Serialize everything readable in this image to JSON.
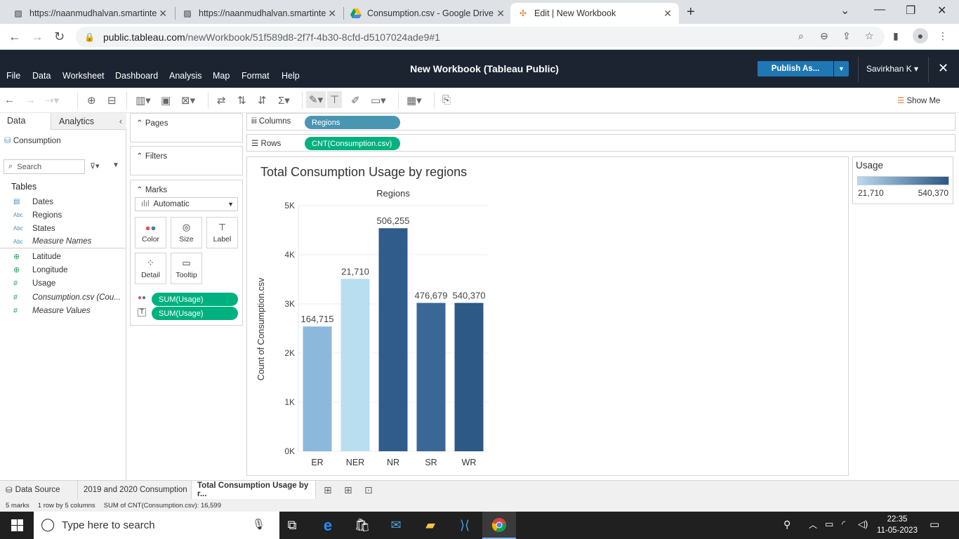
{
  "browser": {
    "tabs": [
      {
        "title": "https://naanmudhalvan.smartinte",
        "active": false
      },
      {
        "title": "https://naanmudhalvan.smartinte",
        "active": false
      },
      {
        "title": "Consumption.csv - Google Drive",
        "active": false
      },
      {
        "title": "Edit | New Workbook",
        "active": true
      }
    ],
    "url_host": "public.tableau.com",
    "url_path": "/newWorkbook/51f589d8-2f7f-4b30-8cfd-d5107024ade9#1"
  },
  "app": {
    "menu": [
      "File",
      "Data",
      "Worksheet",
      "Dashboard",
      "Analysis",
      "Map",
      "Format",
      "Help"
    ],
    "title": "New Workbook (Tableau Public)",
    "publish_label": "Publish As...",
    "user": "Savirkhan K"
  },
  "toolbar": {
    "show_me": "Show Me"
  },
  "data_pane": {
    "tab_data": "Data",
    "tab_analytics": "Analytics",
    "datasource": "Consumption",
    "search_placeholder": "Search",
    "tables_heading": "Tables",
    "fields": [
      {
        "name": "Dates",
        "type": "date",
        "icon": "calendar-icon",
        "italic": false
      },
      {
        "name": "Regions",
        "type": "Abc",
        "icon": "string-icon",
        "italic": false
      },
      {
        "name": "States",
        "type": "Abc",
        "icon": "string-icon",
        "italic": false
      },
      {
        "name": "Measure Names",
        "type": "Abc",
        "icon": "string-icon",
        "italic": true
      },
      {
        "name": "Latitude",
        "type": "geo",
        "icon": "globe-icon",
        "italic": false
      },
      {
        "name": "Longitude",
        "type": "geo",
        "icon": "globe-icon",
        "italic": false
      },
      {
        "name": "Usage",
        "type": "#",
        "icon": "number-icon",
        "italic": false
      },
      {
        "name": "Consumption.csv (Cou...",
        "type": "#",
        "icon": "number-icon",
        "italic": true
      },
      {
        "name": "Measure Values",
        "type": "#",
        "icon": "number-icon",
        "italic": true
      }
    ]
  },
  "cards": {
    "pages": "Pages",
    "filters": "Filters",
    "marks": "Marks",
    "marks_type": "Automatic",
    "mark_buttons": [
      "Color",
      "Size",
      "Label",
      "Detail",
      "Tooltip"
    ],
    "mark_pills": [
      "SUM(Usage)",
      "SUM(Usage)"
    ]
  },
  "shelves": {
    "columns_label": "Columns",
    "columns_pill": "Regions",
    "rows_label": "Rows",
    "rows_pill": "CNT(Consumption.csv)"
  },
  "legend": {
    "title": "Usage",
    "min": "21,710",
    "max": "540,370",
    "color_low": "#b9d9ef",
    "color_high": "#2a5783"
  },
  "chart_data": {
    "type": "bar",
    "title": "Total Consumption Usage by regions",
    "column_header": "Regions",
    "ylabel": "Count of Consumption.csv",
    "ylim": [
      0,
      5000
    ],
    "yticks": [
      "0K",
      "1K",
      "2K",
      "3K",
      "4K",
      "5K"
    ],
    "ytick_values": [
      0,
      1000,
      2000,
      3000,
      4000,
      5000
    ],
    "categories": [
      "ER",
      "NER",
      "NR",
      "SR",
      "WR"
    ],
    "values": [
      2540,
      3510,
      4540,
      3020,
      3020
    ],
    "labels": [
      "164,715",
      "21,710",
      "506,255",
      "476,679",
      "540,370"
    ],
    "colors": [
      "#8cb8db",
      "#b9def0",
      "#305c8c",
      "#3b6797",
      "#2d5987"
    ]
  },
  "sheet_tabs": {
    "data_source": "Data Source",
    "tabs": [
      "2019 and 2020 Consumption",
      "Total Consumption Usage by r..."
    ]
  },
  "status": {
    "marks": "5 marks",
    "rows": "1 row by 5 columns",
    "sum": "SUM of CNT(Consumption.csv): 16,599"
  },
  "taskbar": {
    "search_placeholder": "Type here to search",
    "time": "22:35",
    "date": "11-05-2023"
  }
}
